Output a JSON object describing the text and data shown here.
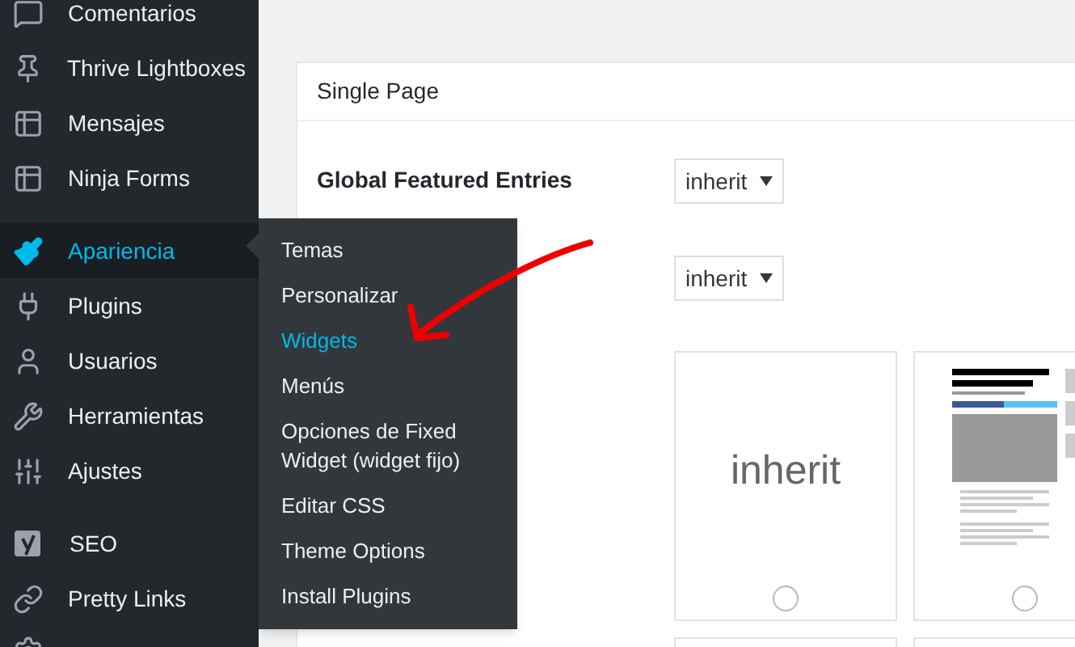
{
  "sidebar": {
    "items": [
      {
        "label": "Comentarios",
        "selected": false
      },
      {
        "label": "Thrive Lightboxes",
        "selected": false
      },
      {
        "label": "Mensajes",
        "selected": false
      },
      {
        "label": "Ninja Forms",
        "selected": false
      },
      {
        "label": "Apariencia",
        "selected": true
      },
      {
        "label": "Plugins",
        "selected": false
      },
      {
        "label": "Usuarios",
        "selected": false
      },
      {
        "label": "Herramientas",
        "selected": false
      },
      {
        "label": "Ajustes",
        "selected": false
      },
      {
        "label": "SEO",
        "selected": false
      },
      {
        "label": "Pretty Links",
        "selected": false
      }
    ]
  },
  "submenu": {
    "items": [
      {
        "label": "Temas",
        "selected": false
      },
      {
        "label": "Personalizar",
        "selected": false
      },
      {
        "label": "Widgets",
        "selected": true
      },
      {
        "label": "Menús",
        "selected": false
      },
      {
        "label": "Opciones de Fixed Widget (widget fijo)",
        "selected": false
      },
      {
        "label": "Editar CSS",
        "selected": false
      },
      {
        "label": "Theme Options",
        "selected": false
      },
      {
        "label": "Install Plugins",
        "selected": false
      }
    ]
  },
  "panel": {
    "title": "Single Page",
    "settings": [
      {
        "label": "Global Featured Entries",
        "value": "inherit"
      },
      {
        "value": "inherit"
      }
    ],
    "layout_options": [
      {
        "kind": "text",
        "label": "inherit",
        "selected": false
      },
      {
        "kind": "preview",
        "selected": false
      }
    ]
  }
}
